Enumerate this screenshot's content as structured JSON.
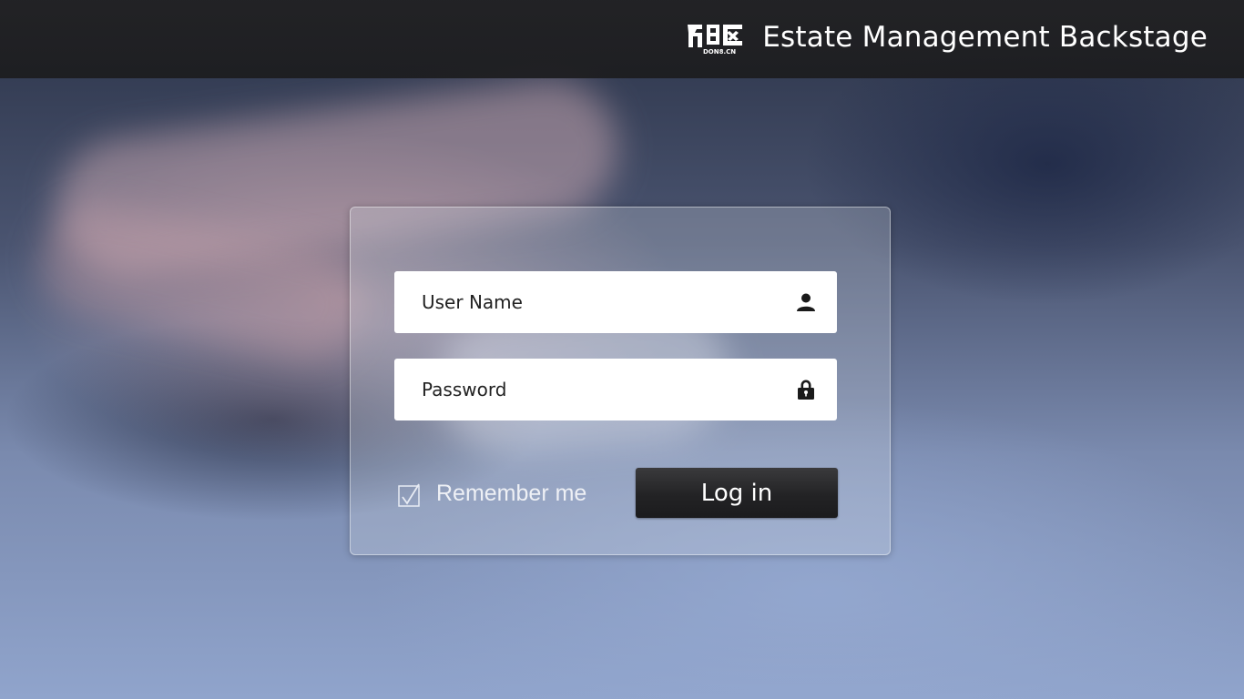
{
  "header": {
    "title": "Estate Management Backstage",
    "logo_icon": "dong8-logo-icon"
  },
  "login": {
    "username_placeholder": "User Name",
    "username_icon": "user-icon",
    "password_placeholder": "Password",
    "password_icon": "lock-icon",
    "remember_label": "Remember me",
    "remember_checked": true,
    "login_label": "Log in"
  },
  "colors": {
    "topbar": "#222224",
    "button": "#232325",
    "field": "#ffffff"
  }
}
